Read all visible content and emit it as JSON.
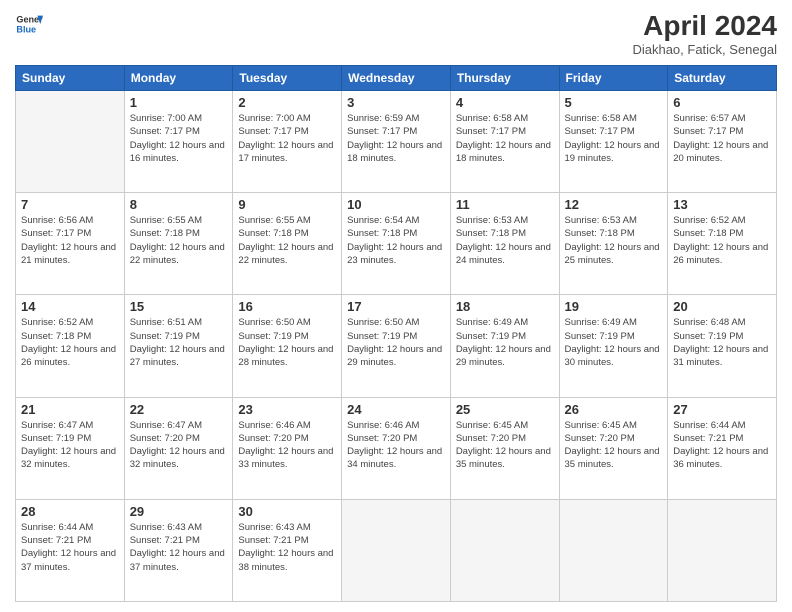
{
  "header": {
    "logo_line1": "General",
    "logo_line2": "Blue",
    "title": "April 2024",
    "location": "Diakhao, Fatick, Senegal"
  },
  "weekdays": [
    "Sunday",
    "Monday",
    "Tuesday",
    "Wednesday",
    "Thursday",
    "Friday",
    "Saturday"
  ],
  "weeks": [
    [
      {
        "day": "",
        "empty": true
      },
      {
        "day": "1",
        "sunrise": "7:00 AM",
        "sunset": "7:17 PM",
        "daylight": "12 hours and 16 minutes."
      },
      {
        "day": "2",
        "sunrise": "7:00 AM",
        "sunset": "7:17 PM",
        "daylight": "12 hours and 17 minutes."
      },
      {
        "day": "3",
        "sunrise": "6:59 AM",
        "sunset": "7:17 PM",
        "daylight": "12 hours and 18 minutes."
      },
      {
        "day": "4",
        "sunrise": "6:58 AM",
        "sunset": "7:17 PM",
        "daylight": "12 hours and 18 minutes."
      },
      {
        "day": "5",
        "sunrise": "6:58 AM",
        "sunset": "7:17 PM",
        "daylight": "12 hours and 19 minutes."
      },
      {
        "day": "6",
        "sunrise": "6:57 AM",
        "sunset": "7:17 PM",
        "daylight": "12 hours and 20 minutes."
      }
    ],
    [
      {
        "day": "7",
        "sunrise": "6:56 AM",
        "sunset": "7:17 PM",
        "daylight": "12 hours and 21 minutes."
      },
      {
        "day": "8",
        "sunrise": "6:55 AM",
        "sunset": "7:18 PM",
        "daylight": "12 hours and 22 minutes."
      },
      {
        "day": "9",
        "sunrise": "6:55 AM",
        "sunset": "7:18 PM",
        "daylight": "12 hours and 22 minutes."
      },
      {
        "day": "10",
        "sunrise": "6:54 AM",
        "sunset": "7:18 PM",
        "daylight": "12 hours and 23 minutes."
      },
      {
        "day": "11",
        "sunrise": "6:53 AM",
        "sunset": "7:18 PM",
        "daylight": "12 hours and 24 minutes."
      },
      {
        "day": "12",
        "sunrise": "6:53 AM",
        "sunset": "7:18 PM",
        "daylight": "12 hours and 25 minutes."
      },
      {
        "day": "13",
        "sunrise": "6:52 AM",
        "sunset": "7:18 PM",
        "daylight": "12 hours and 26 minutes."
      }
    ],
    [
      {
        "day": "14",
        "sunrise": "6:52 AM",
        "sunset": "7:18 PM",
        "daylight": "12 hours and 26 minutes."
      },
      {
        "day": "15",
        "sunrise": "6:51 AM",
        "sunset": "7:19 PM",
        "daylight": "12 hours and 27 minutes."
      },
      {
        "day": "16",
        "sunrise": "6:50 AM",
        "sunset": "7:19 PM",
        "daylight": "12 hours and 28 minutes."
      },
      {
        "day": "17",
        "sunrise": "6:50 AM",
        "sunset": "7:19 PM",
        "daylight": "12 hours and 29 minutes."
      },
      {
        "day": "18",
        "sunrise": "6:49 AM",
        "sunset": "7:19 PM",
        "daylight": "12 hours and 29 minutes."
      },
      {
        "day": "19",
        "sunrise": "6:49 AM",
        "sunset": "7:19 PM",
        "daylight": "12 hours and 30 minutes."
      },
      {
        "day": "20",
        "sunrise": "6:48 AM",
        "sunset": "7:19 PM",
        "daylight": "12 hours and 31 minutes."
      }
    ],
    [
      {
        "day": "21",
        "sunrise": "6:47 AM",
        "sunset": "7:19 PM",
        "daylight": "12 hours and 32 minutes."
      },
      {
        "day": "22",
        "sunrise": "6:47 AM",
        "sunset": "7:20 PM",
        "daylight": "12 hours and 32 minutes."
      },
      {
        "day": "23",
        "sunrise": "6:46 AM",
        "sunset": "7:20 PM",
        "daylight": "12 hours and 33 minutes."
      },
      {
        "day": "24",
        "sunrise": "6:46 AM",
        "sunset": "7:20 PM",
        "daylight": "12 hours and 34 minutes."
      },
      {
        "day": "25",
        "sunrise": "6:45 AM",
        "sunset": "7:20 PM",
        "daylight": "12 hours and 35 minutes."
      },
      {
        "day": "26",
        "sunrise": "6:45 AM",
        "sunset": "7:20 PM",
        "daylight": "12 hours and 35 minutes."
      },
      {
        "day": "27",
        "sunrise": "6:44 AM",
        "sunset": "7:21 PM",
        "daylight": "12 hours and 36 minutes."
      }
    ],
    [
      {
        "day": "28",
        "sunrise": "6:44 AM",
        "sunset": "7:21 PM",
        "daylight": "12 hours and 37 minutes."
      },
      {
        "day": "29",
        "sunrise": "6:43 AM",
        "sunset": "7:21 PM",
        "daylight": "12 hours and 37 minutes."
      },
      {
        "day": "30",
        "sunrise": "6:43 AM",
        "sunset": "7:21 PM",
        "daylight": "12 hours and 38 minutes."
      },
      {
        "day": "",
        "empty": true
      },
      {
        "day": "",
        "empty": true
      },
      {
        "day": "",
        "empty": true
      },
      {
        "day": "",
        "empty": true
      }
    ]
  ]
}
